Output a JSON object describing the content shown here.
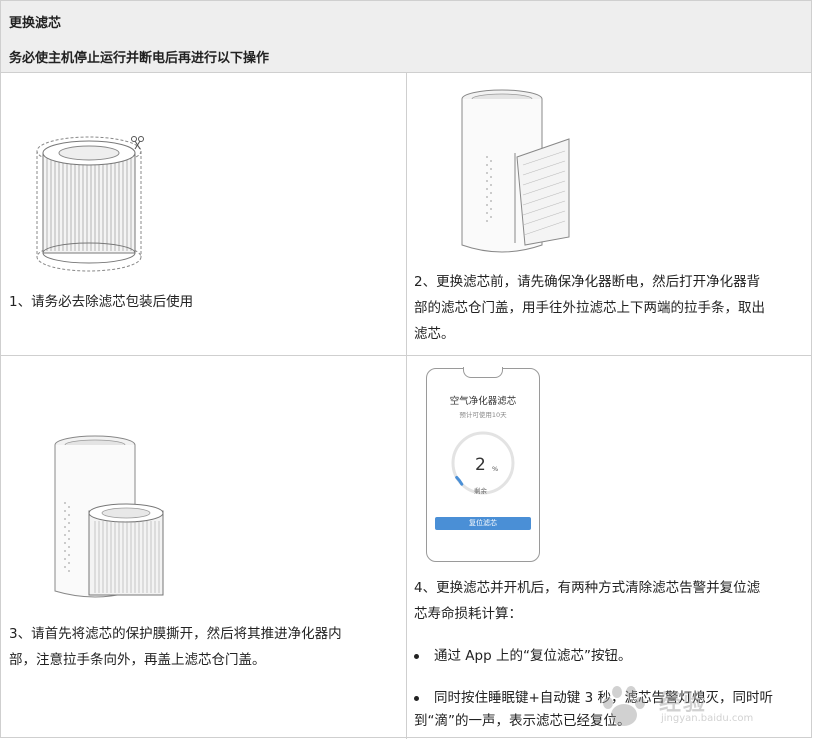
{
  "header": {
    "title": "更换滤芯",
    "subtitle": "务必使主机停止运行并断电后再进行以下操作"
  },
  "steps": [
    {
      "text": "1、请务必去除滤芯包装后使用",
      "illustration": "filter-cartridge-with-scissors"
    },
    {
      "text_lines": [
        "2、更换滤芯前，请先确保净化器断电，然后打开净化器背",
        "部的滤芯仓门盖，用手往外拉滤芯上下两端的拉手条，取出",
        "滤芯。"
      ],
      "illustration": "purifier-rear-cover-open"
    },
    {
      "text_lines": [
        "3、请首先将滤芯的保护膜撕开，然后将其推进净化器内",
        "部，注意拉手条向外，再盖上滤芯仓门盖。"
      ],
      "illustration": "purifier-filter-insert"
    },
    {
      "text_lines": [
        "4、更换滤芯并开机后，有两种方式清除滤芯告警并复位滤",
        "芯寿命损耗计算："
      ],
      "bullets": [
        {
          "lines": [
            "通过 App 上的“复位滤芯”按钮。"
          ]
        },
        {
          "lines": [
            "同时按住睡眠键+自动键 3 秒，滤芯告警灯熄灭，同时听",
            "到“滴”的一声，表示滤芯已经复位。"
          ]
        }
      ]
    }
  ],
  "app_screen": {
    "title": "空气净化器滤芯",
    "subtitle": "预计可使用10天",
    "value": "2",
    "unit": "%",
    "remaining_label": "剩余",
    "remaining_fraction": 0.02,
    "button_label": "复位滤芯",
    "accent_color": "#4a8fd6"
  },
  "watermark": {
    "main": "经验",
    "sub": "jingyan.baidu.com"
  }
}
